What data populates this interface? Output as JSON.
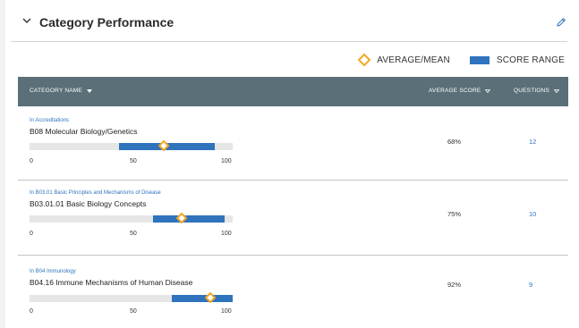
{
  "header": {
    "title": "Category Performance",
    "collapse_icon": "chevron-down-icon",
    "edit_icon": "pencil-icon"
  },
  "legend": {
    "mean_label": "AVERAGE/MEAN",
    "range_label": "SCORE RANGE",
    "mean_color": "#f5a623",
    "range_color": "#2f73bd"
  },
  "table": {
    "header_bg": "#5a6f78",
    "columns": {
      "category": "CATEGORY NAME",
      "score": "AVERAGE SCORE",
      "questions": "QUESTIONS"
    },
    "axis_ticks": [
      "0",
      "50",
      "100"
    ],
    "rows": [
      {
        "breadcrumb": "In Accreditations",
        "name": "B08 Molecular Biology/Genetics",
        "range_low": 44,
        "range_high": 91,
        "mean": 66,
        "score": "68%",
        "questions": "12"
      },
      {
        "breadcrumb": "In B03.01 Basic Principles and Mechanisms of Disease",
        "name": "B03.01.01 Basic Biology Concepts",
        "range_low": 61,
        "range_high": 96,
        "mean": 75,
        "score": "75%",
        "questions": "10"
      },
      {
        "breadcrumb": "In B04 Immunology",
        "name": "B04.16 Immune Mechanisms of Human Disease",
        "range_low": 70,
        "range_high": 100,
        "mean": 89,
        "score": "92%",
        "questions": "9"
      }
    ]
  }
}
